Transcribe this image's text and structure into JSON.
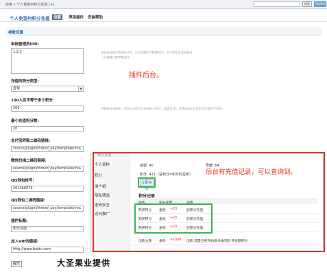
{
  "topbar": {
    "breadcrumb": "应用 » 个人免签约积分充值 [+]",
    "search_button": "搜索",
    "add_new": "添加常用"
  },
  "header": {
    "title": "个人免签约积分充值",
    "tabs": [
      {
        "label": "设置",
        "active": true
      },
      {
        "label": "停用插件",
        "active": false
      },
      {
        "label": "安装帮助",
        "active": false
      }
    ]
  },
  "section": {
    "title": "参数设置"
  },
  "form": {
    "uid_label": "审核管理员UID:",
    "uid_value": "1,2,3",
    "uid_hint_1": "请在此处填写管理员UID，可以设置多个管理员ID，多个用英文逗号隔开",
    "uid_hint_2": "（只能输入数字和逗号）",
    "credit_type_label": "充值的积分类型:",
    "credit_type_value": "金钱",
    "rate_label": "100人民币等于多少积分：",
    "rate_value": "200",
    "rate_hint": "不能积分兑换率，100元人民币可兑换多少积分，如填写20，代表100元人民币可兑换20个积分",
    "min_label": "最小充值积分数:",
    "min_value": "20",
    "alipay_qr_label": "支付宝转账二维码链接:",
    "alipay_qr_value": "source/plugin/threed_pay/template/ima",
    "wechat_qr_label": "微信扫描二维码链接:",
    "wechat_qr_value": "source/plugin/threed_pay/template/ima",
    "qq_account_label": "QQ钱包帐号:",
    "qq_account_value": "261366875",
    "qq_qr_label": "QQ钱包二维码链接:",
    "qq_qr_value": "source/plugin/threed_pay/template/ima",
    "plugin_title_label": "插件标题:",
    "plugin_title_value": "积分充值",
    "vip_label": "加入VIP的链接:",
    "vip_value": "http://www.baidu.com",
    "submit": "提交"
  },
  "annotations": {
    "plugin_backend": "插件后台。",
    "backend_records": "后台有充值记录，可以查询到。",
    "provider": "大圣果业提供"
  },
  "inset": {
    "sidebar": [
      "个人资料",
      "积分",
      "用户组",
      "隐私筛选",
      "密码安全",
      "访问推广"
    ],
    "top_text": "积分充值",
    "prestige": "威望: 40",
    "contribution": "贡献: 64",
    "credits": "积分: 421（总积分=积分的总和）",
    "charge_button": "立即充值",
    "records_title": "积分记录",
    "columns": [
      "操作",
      "积分变更",
      "详情"
    ],
    "rows": [
      [
        "购买积分",
        "金钱",
        "+20",
        "后积分充值"
      ],
      [
        "购买积分",
        "金钱",
        "+20",
        "后积分充值"
      ],
      [
        "购买积分",
        "金钱",
        "+20",
        "后积分充值"
      ],
      [
        "出售主题",
        "金钱",
        "+1000",
        "出售 这是已经开始技术顾问的 评论题积分"
      ]
    ]
  }
}
